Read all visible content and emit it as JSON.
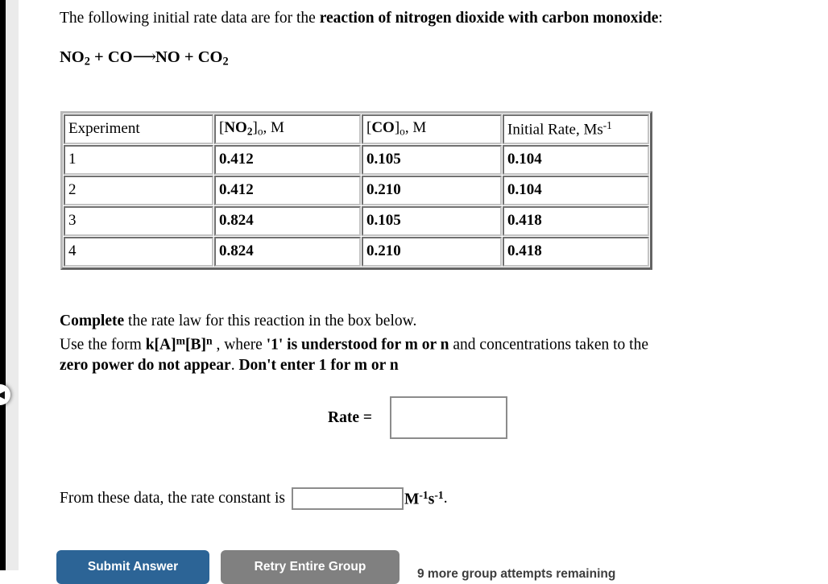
{
  "sidebar": {
    "toggle_icon": "chevron-left-icon"
  },
  "problem": {
    "intro_prefix": "The following initial rate data are for the ",
    "intro_bold": "reaction of nitrogen dioxide with carbon monoxide",
    "intro_suffix": ":",
    "equation": {
      "reactant_1": "NO",
      "reactant_1_sub": "2",
      "plus_1": " + ",
      "reactant_2": "CO",
      "arrow": "⟶",
      "product_1": "NO",
      "plus_2": " + ",
      "product_2": "CO",
      "product_2_sub": "2"
    }
  },
  "table": {
    "headers": [
      {
        "text": "Experiment",
        "bold_part": "",
        "sub": "",
        "tail": ""
      },
      {
        "text": "[",
        "bold_part": "NO",
        "bold_sub": "2",
        "bracket_close": "]",
        "sub": "o",
        "tail": ", M"
      },
      {
        "text": "[",
        "bold_part": "CO",
        "bold_sub": "",
        "bracket_close": "]",
        "sub": "o",
        "tail": ", M"
      },
      {
        "text": "Initial Rate, Ms",
        "sup": "-1"
      }
    ],
    "header_labels": [
      "Experiment",
      "[NO2]o, M",
      "[CO]o, M",
      "Initial Rate, Ms-1"
    ],
    "rows": [
      {
        "experiment": "1",
        "no2": "0.412",
        "co": "0.105",
        "rate": "0.104"
      },
      {
        "experiment": "2",
        "no2": "0.412",
        "co": "0.210",
        "rate": "0.104"
      },
      {
        "experiment": "3",
        "no2": "0.824",
        "co": "0.105",
        "rate": "0.418"
      },
      {
        "experiment": "4",
        "no2": "0.824",
        "co": "0.210",
        "rate": "0.418"
      }
    ]
  },
  "instructions": {
    "line1_bold": "Complete",
    "line1_rest": " the rate law for this reaction in the box below.",
    "line2_a": "Use the form ",
    "line2_k": "k[A]",
    "line2_m": "m",
    "line2_b": "[B]",
    "line2_n": "n",
    "line2_c": " , where ",
    "line2_quote": "'1' is understood for m or n",
    "line2_d": " and concentrations taken to the",
    "line3_bold_a": "zero power do not appear",
    "line3_mid": ". ",
    "line3_bold_b": "Don't enter 1 for m or n"
  },
  "rate_entry": {
    "label": "Rate =",
    "value": "",
    "placeholder": ""
  },
  "rate_constant": {
    "prompt": "From these data, the rate constant is",
    "value": "",
    "placeholder": "",
    "units_m": "M",
    "units_m_sup": "-1",
    "units_s": "s",
    "units_s_sup": "-1",
    "period": "."
  },
  "footer": {
    "submit_label": "Submit Answer",
    "retry_label": "Retry Entire Group",
    "attempts_text": "9 more group attempts remaining"
  },
  "colors": {
    "submit_blue": "#2c6496",
    "retry_gray": "#808080",
    "input_border": "#8c8c8c"
  }
}
